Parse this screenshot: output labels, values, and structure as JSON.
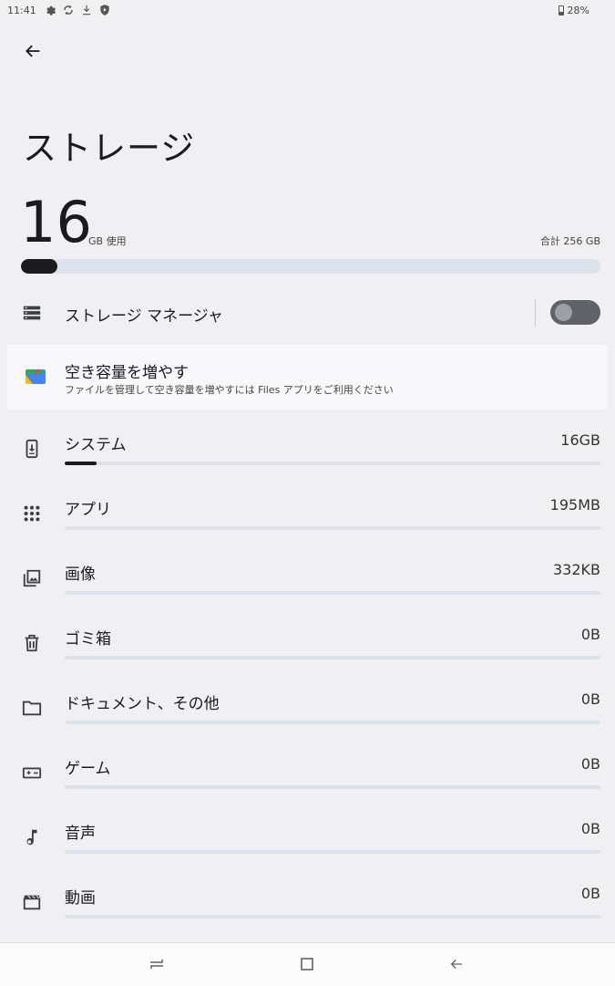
{
  "status_bar": {
    "time": "11:41",
    "battery": "28%"
  },
  "header": {
    "title": "ストレージ"
  },
  "usage": {
    "used_value": "16",
    "used_unit": "GB 使用",
    "total": "合計 256 GB",
    "fraction": 0.0625
  },
  "storage_manager": {
    "label": "ストレージ マネージャ",
    "enabled": false
  },
  "free_up": {
    "title": "空き容量を増やす",
    "subtitle": "ファイルを管理して空き容量を増やすには Files アプリをご利用ください"
  },
  "categories": [
    {
      "label": "システム",
      "value": "16GB",
      "fraction": 0.06,
      "icon": "system-update-icon"
    },
    {
      "label": "アプリ",
      "value": "195MB",
      "fraction": 0.0,
      "icon": "apps-grid-icon"
    },
    {
      "label": "画像",
      "value": "332KB",
      "fraction": 0.0,
      "icon": "photo-library-icon"
    },
    {
      "label": "ゴミ箱",
      "value": "0B",
      "fraction": 0.0,
      "icon": "trash-icon"
    },
    {
      "label": "ドキュメント、その他",
      "value": "0B",
      "fraction": 0.0,
      "icon": "folder-icon"
    },
    {
      "label": "ゲーム",
      "value": "0B",
      "fraction": 0.0,
      "icon": "gamepad-icon"
    },
    {
      "label": "音声",
      "value": "0B",
      "fraction": 0.0,
      "icon": "music-note-icon"
    },
    {
      "label": "動画",
      "value": "0B",
      "fraction": 0.0,
      "icon": "movie-icon"
    }
  ]
}
